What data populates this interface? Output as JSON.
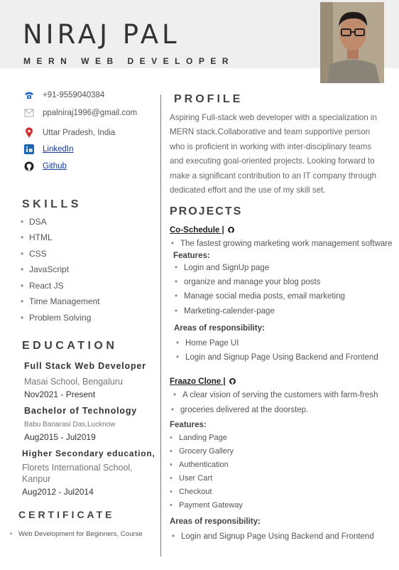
{
  "header": {
    "name": "NIRAJ PAL",
    "role": "MERN WEB DEVELOPER"
  },
  "contact": {
    "phone": "+91-9559040384",
    "email": "ppalniraj1996@gmail.com",
    "location": "Uttar Pradesh, India",
    "linkedin": "LinkedIn",
    "github": "Github"
  },
  "skills": {
    "title": "SKILLS",
    "items": [
      "DSA",
      "HTML",
      "CSS",
      "JavaScript",
      "React JS",
      "Time Management",
      "Problem Solving"
    ]
  },
  "education": {
    "title": "EDUCATION",
    "entries": [
      {
        "degree": "Full Stack Web Developer",
        "school": "Masai School, Bengaluru",
        "dates": "Nov2021 - Present"
      },
      {
        "degree": "Bachelor of Technology",
        "school": "Babu Banarasi  Das,Lucknow",
        "dates": "Aug2015 - Jul2019"
      },
      {
        "degree": "Higher Secondary education,",
        "school_line1": "Florets International School,",
        "school_line2": "Kanpur",
        "dates": "Aug2012 - Jul2014"
      }
    ]
  },
  "certificate": {
    "title": "CERTIFICATE",
    "text": "Web Development for Beginners, Course"
  },
  "profile": {
    "title": "PROFILE",
    "text": "Aspiring Full-stack web developer with a specialization in MERN stack.Collaborative and team supportive person who is proficient in working with inter-disciplinary teams and executing goal-oriented projects. Looking forward to make a significant contribution to an IT company through dedicated effort and the use of my skill set."
  },
  "projects": {
    "title": "PROJECTS",
    "items": [
      {
        "name": "Co-Schedule |",
        "description": "The fastest growing marketing work management software",
        "features_label": "Features:",
        "features": [
          "Login and SignUp page",
          "organize and manage your blog posts",
          "Manage social media posts, email marketing",
          "Marketing-calender-page"
        ],
        "resp_label": "Areas of responsibility:",
        "responsibilities": [
          "Home Page UI",
          "Login and Signup Page Using Backend and Frontend"
        ]
      },
      {
        "name": "Fraazo Clone |",
        "description_line1": "A clear vision of serving the customers with farm-fresh",
        "description_line2": "groceries delivered at the doorstep.",
        "features_label": "Features:",
        "features": [
          "Landing Page",
          "Grocery Gallery",
          "Authentication",
          "User Cart",
          "Checkout",
          "Payment Gateway"
        ],
        "resp_label": "Areas of responsibility:",
        "responsibilities": [
          "Login and Signup Page Using Backend and Frontend"
        ]
      }
    ]
  },
  "colors": {
    "header_band": "#efefef",
    "link": "#1a3a9c",
    "phone_icon": "#1e63c8",
    "location_icon": "#d32f2f",
    "linkedin_icon": "#1b66b3"
  }
}
